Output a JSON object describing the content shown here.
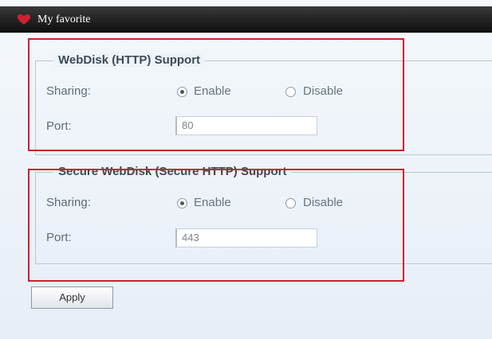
{
  "window": {
    "title": "My favorite"
  },
  "webdisk_http": {
    "legend": "WebDisk (HTTP) Support",
    "sharing_label": "Sharing:",
    "enable_label": "Enable",
    "disable_label": "Disable",
    "sharing_value": "Enable",
    "port_label": "Port:",
    "port_value": "80"
  },
  "webdisk_https": {
    "legend": "Secure WebDisk (Secure HTTP) Support",
    "sharing_label": "Sharing:",
    "enable_label": "Enable",
    "disable_label": "Disable",
    "sharing_value": "Enable",
    "port_label": "Port:",
    "port_value": "443"
  },
  "actions": {
    "apply_label": "Apply"
  },
  "colors": {
    "titlebar": "#1b1b1b",
    "heart": "#d0202e",
    "highlight": "#d21d2b",
    "panel_background": "#eef3f8"
  },
  "icons": {
    "title_icon": "heart-icon"
  }
}
